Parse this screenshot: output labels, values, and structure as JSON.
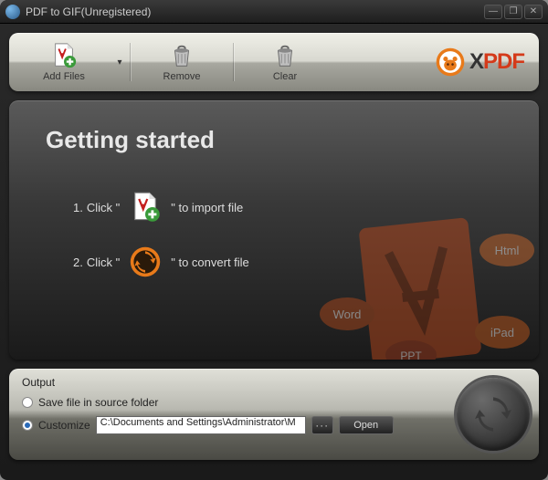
{
  "window": {
    "title": "PDF to GIF(Unregistered)"
  },
  "toolbar": {
    "add_files": "Add Files",
    "remove": "Remove",
    "clear": "Clear",
    "brand_x": "X",
    "brand_pdf": "PDF"
  },
  "main": {
    "heading": "Getting started",
    "step1_num": "1.",
    "step1_pre": "Click \"",
    "step1_post": "\" to import file",
    "step2_num": "2.",
    "step2_pre": "Click \"",
    "step2_post": "\" to convert file"
  },
  "output": {
    "label": "Output",
    "save_source": "Save file in source folder",
    "customize": "Customize",
    "path": "C:\\Documents and Settings\\Administrator\\M",
    "browse": "···",
    "open": "Open"
  },
  "bgart": {
    "tags": [
      "Html",
      "Word",
      "PPT",
      "iPad"
    ]
  },
  "colors": {
    "accent_orange": "#e87a1a",
    "brand_red": "#d43a1a"
  }
}
